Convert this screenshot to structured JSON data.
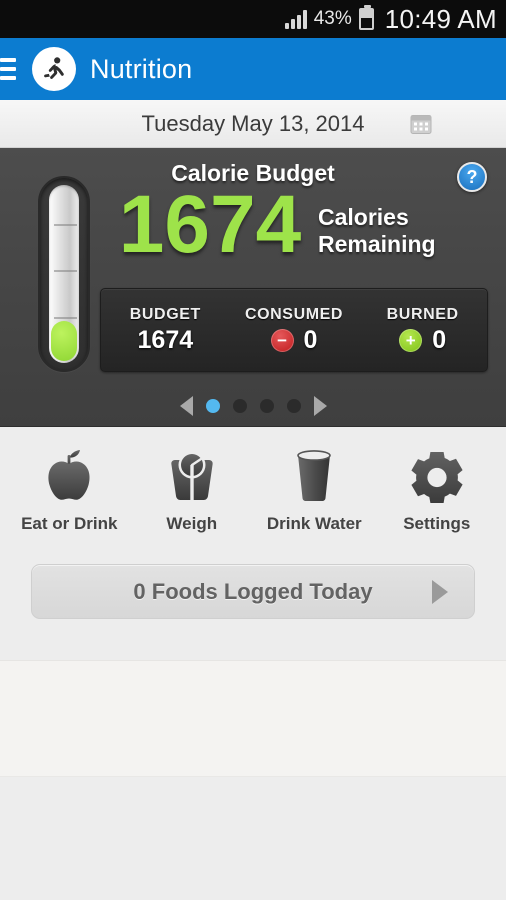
{
  "statusbar": {
    "battery_percent": "43%",
    "time": "10:49 AM",
    "signal_icon": "signal-bars-icon",
    "battery_icon": "battery-icon"
  },
  "appbar": {
    "menu_icon": "hamburger-menu-icon",
    "logo_icon": "running-person-logo-icon",
    "title": "Nutrition",
    "background_color": "#0c7cd0"
  },
  "datebar": {
    "date": "Tuesday May 13, 2014",
    "calendar_icon": "calendar-icon"
  },
  "calorie_card": {
    "title": "Calorie Budget",
    "help_label": "?",
    "remaining_value": "1674",
    "remaining_label_line1": "Calories",
    "remaining_label_line2": "Remaining",
    "remaining_color": "#9ee34a",
    "thermometer_icon": "thermometer-gauge-icon",
    "stats": [
      {
        "label": "BUDGET",
        "value": "1674",
        "badge": "",
        "badge_type": "none"
      },
      {
        "label": "CONSUMED",
        "value": "0",
        "badge": "−",
        "badge_type": "minus",
        "badge_color": "#c01a1c"
      },
      {
        "label": "BURNED",
        "value": "0",
        "badge": "+",
        "badge_type": "plus",
        "badge_color": "#7ec015"
      }
    ],
    "pager": {
      "prev_icon": "arrow-left-icon",
      "next_icon": "arrow-right-icon",
      "total_dots": 4,
      "active_index": 0,
      "active_color": "#54b9f0"
    }
  },
  "quick_actions": [
    {
      "label": "Eat or Drink",
      "icon": "apple-icon"
    },
    {
      "label": "Weigh",
      "icon": "scale-icon"
    },
    {
      "label": "Drink Water",
      "icon": "water-glass-icon"
    },
    {
      "label": "Settings",
      "icon": "gear-icon"
    }
  ],
  "foods_logged": {
    "text": "0 Foods Logged Today",
    "arrow_icon": "arrow-right-icon"
  }
}
